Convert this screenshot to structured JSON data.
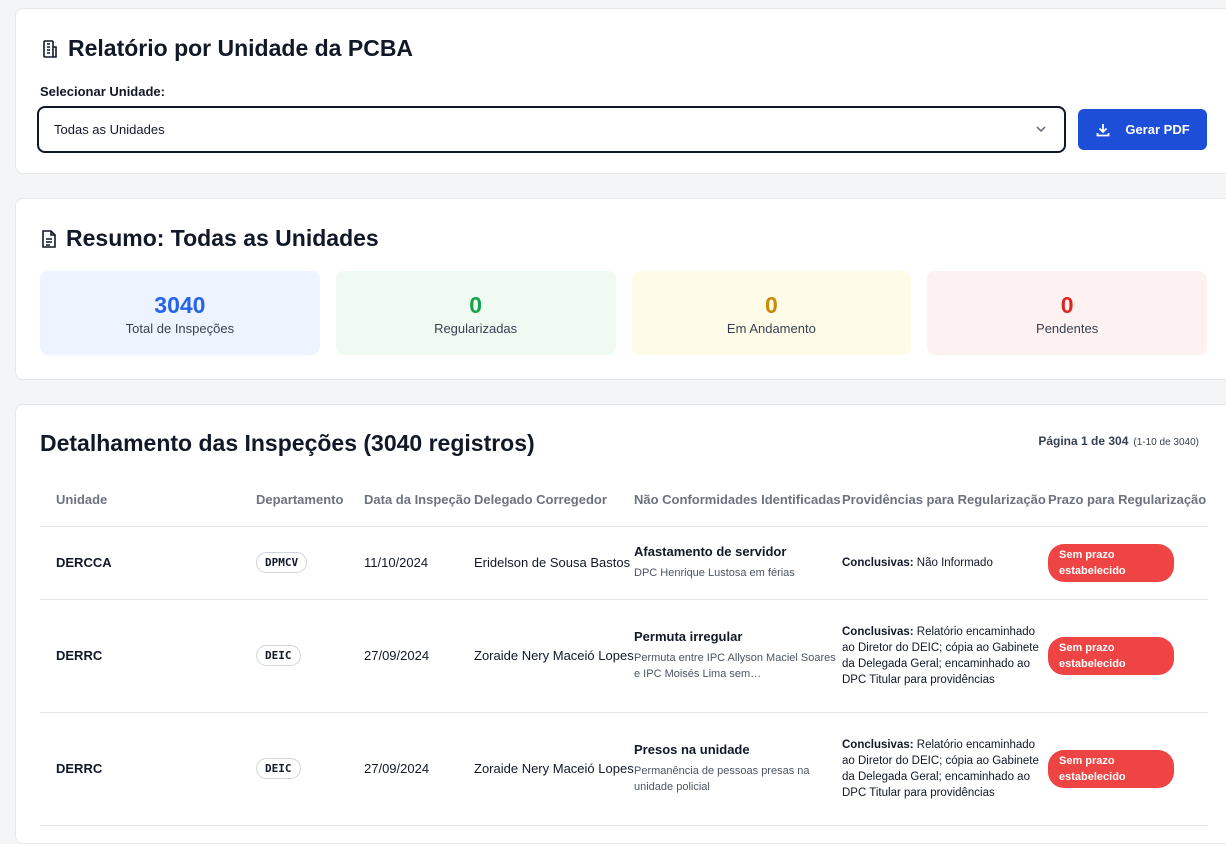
{
  "header": {
    "title": "Relatório por Unidade da PCBA",
    "select_label": "Selecionar Unidade:",
    "select_value": "Todas as Unidades",
    "pdf_button": "Gerar PDF"
  },
  "summary": {
    "title": "Resumo: Todas as Unidades",
    "stats": [
      {
        "value": "3040",
        "label": "Total de Inspeções",
        "color": "#2563eb"
      },
      {
        "value": "0",
        "label": "Regularizadas",
        "color": "#16a34a"
      },
      {
        "value": "0",
        "label": "Em Andamento",
        "color": "#ca8a04"
      },
      {
        "value": "0",
        "label": "Pendentes",
        "color": "#dc2626"
      }
    ]
  },
  "details": {
    "title": "Detalhamento das Inspeções (3040 registros)",
    "page": "Página 1 de 304",
    "range": "(1-10 de 3040)",
    "columns": [
      "Unidade",
      "Departamento",
      "Data da Inspeção",
      "Delegado Corregedor",
      "Não Conformidades Identificadas",
      "Providências para Regularização",
      "Prazo para Regularização"
    ],
    "rows": [
      {
        "unidade": "DERCCA",
        "departamento": "DPMCV",
        "data": "11/10/2024",
        "delegado": "Eridelson de Sousa Bastos",
        "nc_title": "Afastamento de servidor",
        "nc_desc": "DPC Henrique Lustosa em férias",
        "prov_label": "Conclusivas:",
        "prov_text": "Não Informado",
        "prazo": "Sem prazo estabelecido"
      },
      {
        "unidade": "DERRC",
        "departamento": "DEIC",
        "data": "27/09/2024",
        "delegado": "Zoraide Nery Maceió Lopes",
        "nc_title": "Permuta irregular",
        "nc_desc": "Permuta entre IPC Allyson Maciel Soares e IPC Moisés Lima sem…",
        "prov_label": "Conclusivas:",
        "prov_text": "Relatório encaminhado ao Diretor do DEIC; cópia ao Gabinete da Delegada Geral; encaminhado ao DPC Titular para providências",
        "prazo": "Sem prazo estabelecido"
      },
      {
        "unidade": "DERRC",
        "departamento": "DEIC",
        "data": "27/09/2024",
        "delegado": "Zoraide Nery Maceió Lopes",
        "nc_title": "Presos na unidade",
        "nc_desc": "Permanência de pessoas presas na unidade policial",
        "prov_label": "Conclusivas:",
        "prov_text": "Relatório encaminhado ao Diretor do DEIC; cópia ao Gabinete da Delegada Geral; encaminhado ao DPC Titular para providências",
        "prazo": "Sem prazo estabelecido"
      }
    ]
  }
}
